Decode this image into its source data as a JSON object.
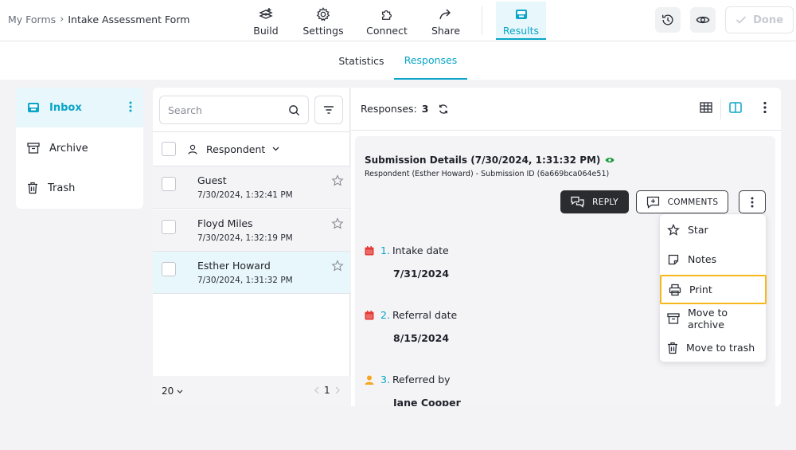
{
  "breadcrumb": {
    "root": "My Forms",
    "separator": "›",
    "current": "Intake Assessment Form"
  },
  "nav": [
    {
      "label": "Build",
      "icon": "build-icon"
    },
    {
      "label": "Settings",
      "icon": "gear-icon"
    },
    {
      "label": "Connect",
      "icon": "puzzle-icon"
    },
    {
      "label": "Share",
      "icon": "share-arrow-icon"
    },
    {
      "label": "Results",
      "icon": "inbox-tray-icon",
      "active": true
    }
  ],
  "header_actions": {
    "history_icon": "history-icon",
    "preview_icon": "eye-icon",
    "done_label": "Done"
  },
  "subtabs": [
    {
      "label": "Statistics"
    },
    {
      "label": "Responses",
      "active": true
    }
  ],
  "sidebar": {
    "items": [
      {
        "label": "Inbox",
        "icon": "inbox-icon",
        "active": true
      },
      {
        "label": "Archive",
        "icon": "archive-icon"
      },
      {
        "label": "Trash",
        "icon": "trash-icon"
      }
    ]
  },
  "list": {
    "search_placeholder": "Search",
    "column_label": "Respondent",
    "rows": [
      {
        "name": "Guest",
        "date": "7/30/2024, 1:32:41 PM"
      },
      {
        "name": "Floyd Miles",
        "date": "7/30/2024, 1:32:19 PM"
      },
      {
        "name": "Esther Howard",
        "date": "7/30/2024, 1:31:32 PM",
        "selected": true
      }
    ],
    "page_size": "20",
    "page": "1"
  },
  "detail": {
    "responses_label": "Responses:",
    "responses_count": "3",
    "title": "Submission Details (7/30/2024, 1:31:32 PM)",
    "subtitle": "Respondent (Esther Howard) - Submission ID (6a669bca064e51)",
    "reply_label": "REPLY",
    "comments_label": "COMMENTS",
    "fields": [
      {
        "num": "1.",
        "label": "Intake date",
        "value": "7/31/2024",
        "icon": "calendar-icon",
        "color": "#e53935"
      },
      {
        "num": "2.",
        "label": "Referral date",
        "value": "8/15/2024",
        "icon": "calendar-icon",
        "color": "#e53935"
      },
      {
        "num": "3.",
        "label": "Referred by",
        "value": "Jane Cooper",
        "icon": "person-icon",
        "color": "#f5a623"
      }
    ]
  },
  "menu": {
    "items": [
      {
        "label": "Star",
        "icon": "star-icon"
      },
      {
        "label": "Notes",
        "icon": "note-icon"
      },
      {
        "label": "Print",
        "icon": "printer-icon",
        "highlighted": true
      },
      {
        "label": "Move to archive",
        "icon": "archive-icon"
      },
      {
        "label": "Move to trash",
        "icon": "trash-icon"
      }
    ]
  },
  "colors": {
    "accent": "#0aa5c8",
    "highlight": "#f5b719",
    "dark_button": "#2b2c30"
  }
}
